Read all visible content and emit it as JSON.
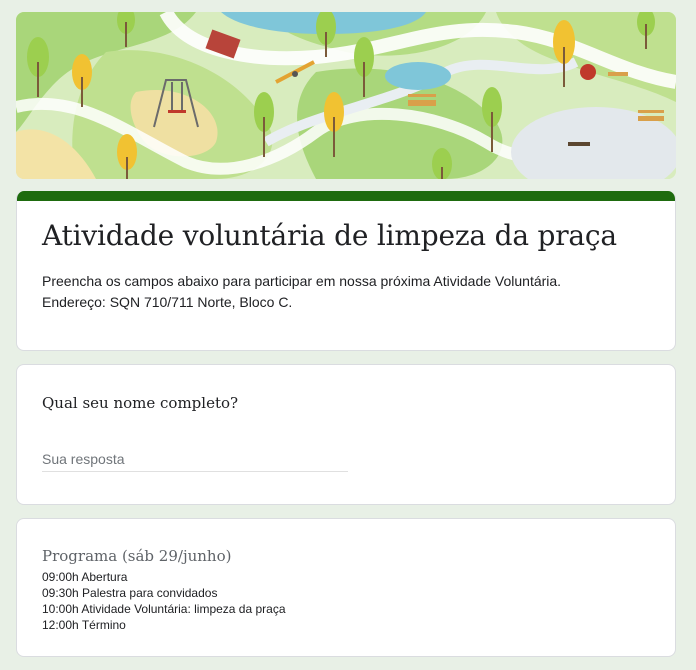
{
  "form": {
    "title": "Atividade voluntária de limpeza da praça",
    "description_lines": [
      "Preencha os campos abaixo para participar em nossa próxima Atividade Voluntária.",
      "Endereço: SQN 710/711 Norte, Bloco C."
    ],
    "accent_color": "#1e6b0e"
  },
  "questions": [
    {
      "title": "Qual seu nome completo?",
      "placeholder": "Sua resposta",
      "value": ""
    }
  ],
  "info_section": {
    "title": "Programa (sáb 29/junho)",
    "lines": [
      "09:00h Abertura",
      "09:30h Palestra para convidados",
      "10:00h Atividade Voluntária: limpeza da praça",
      "12:00h Término"
    ]
  },
  "banner": {
    "theme": "park-illustration"
  }
}
